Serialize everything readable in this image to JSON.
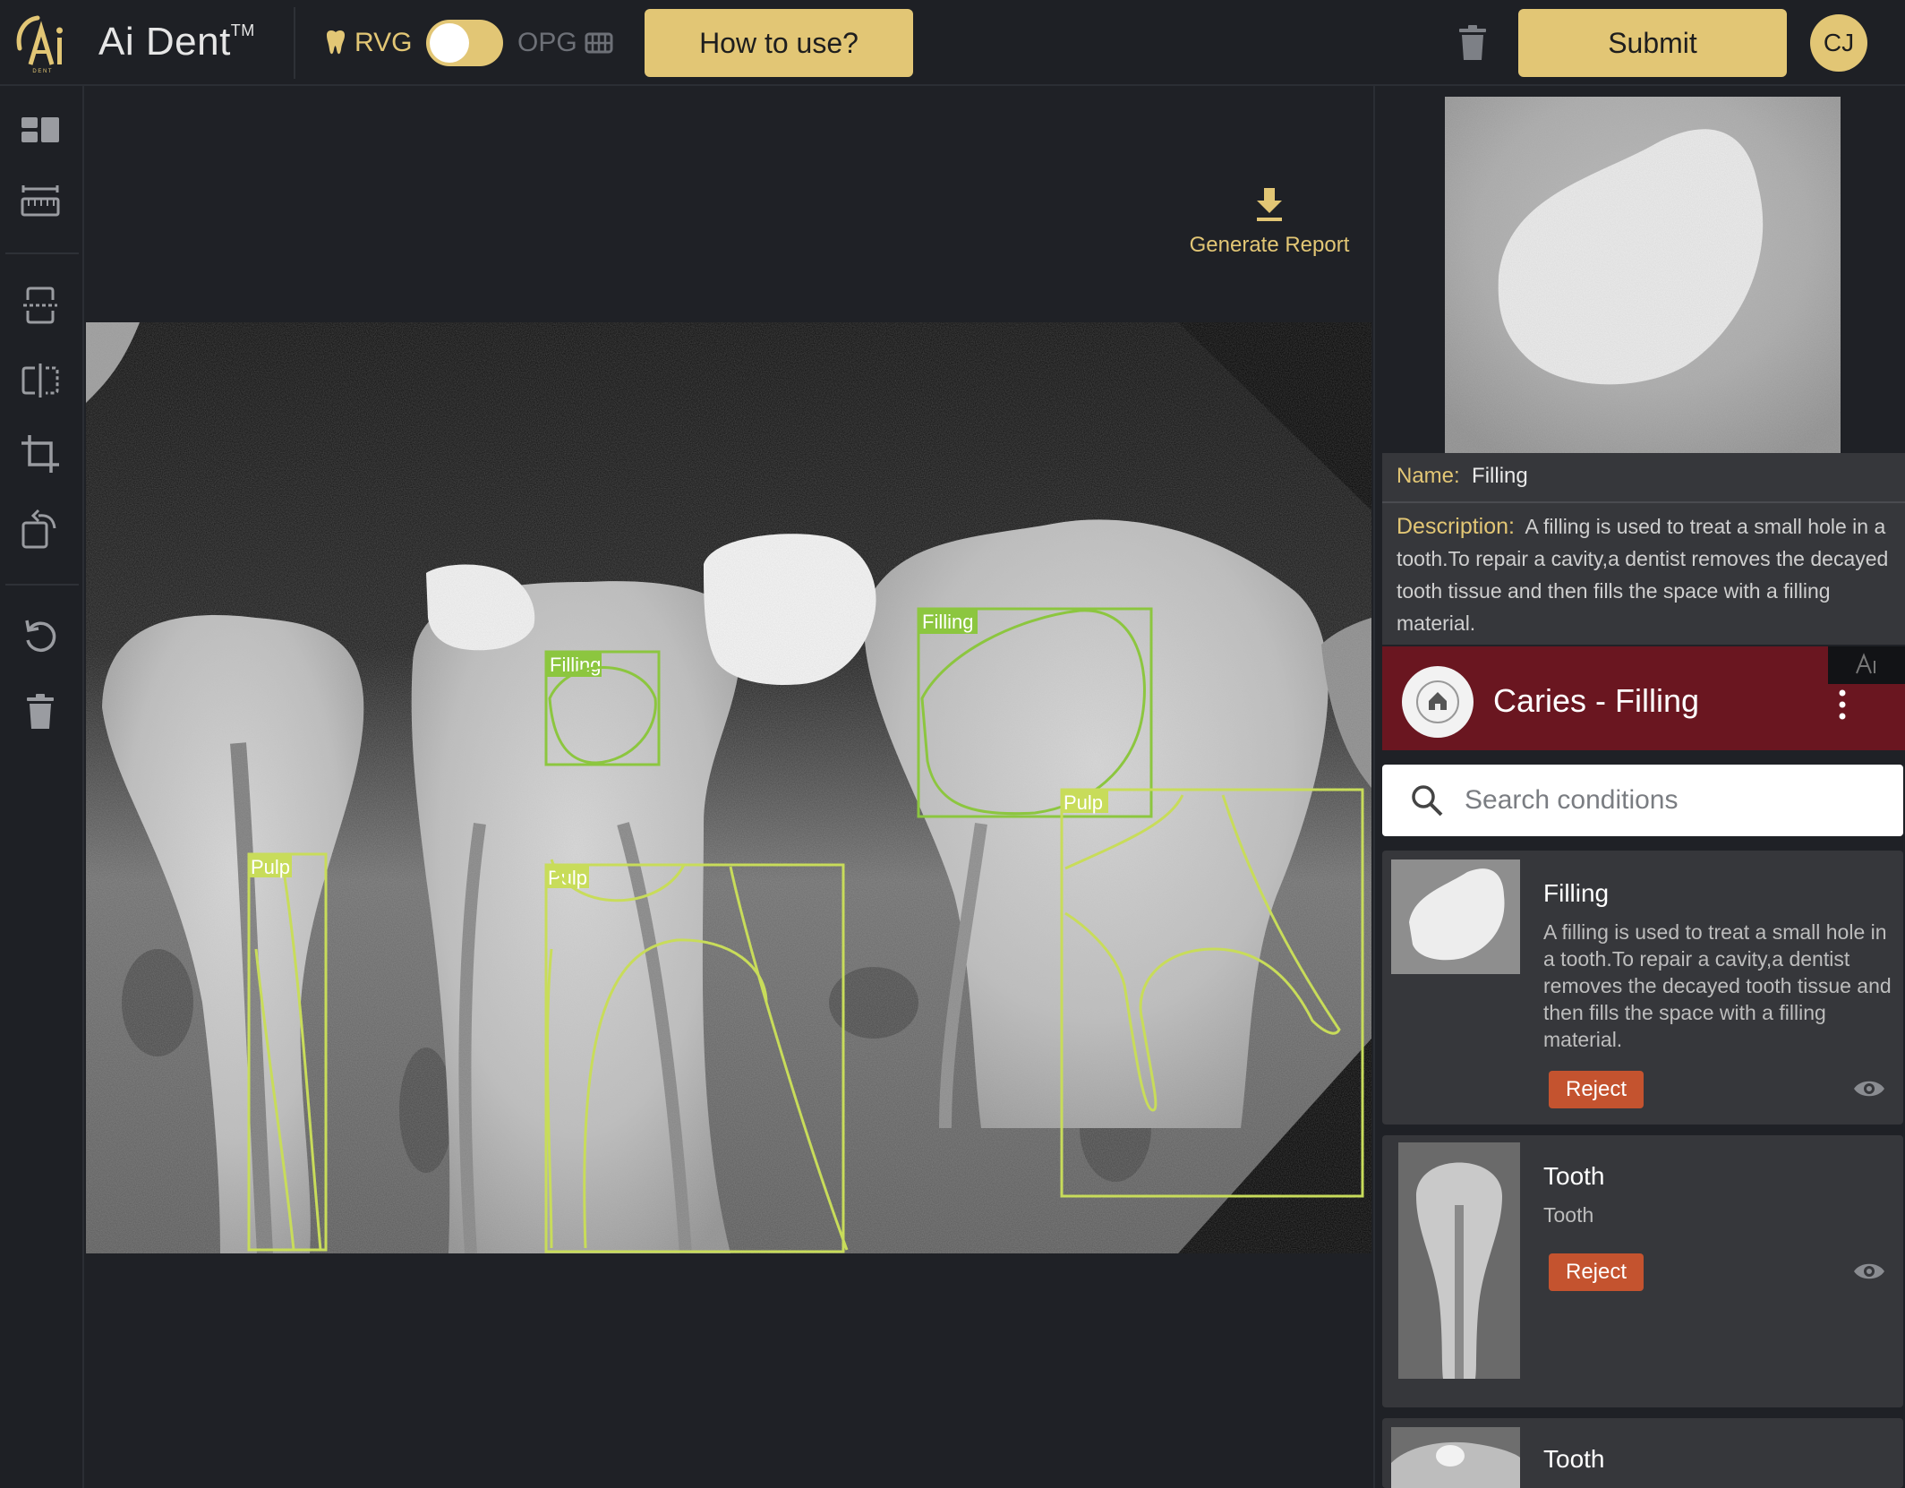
{
  "header": {
    "app_name": "Ai Dent",
    "trademark": "TM",
    "mode_rvg": "RVG",
    "mode_opg": "OPG",
    "how_to_use": "How to use?",
    "submit": "Submit",
    "user_initials": "CJ"
  },
  "toolbar": {
    "generate_report": "Generate Report"
  },
  "xray": {
    "annotations": [
      {
        "label": "Filling",
        "type": "filling"
      },
      {
        "label": "Filling",
        "type": "filling"
      },
      {
        "label": "Pulp",
        "type": "pulp"
      },
      {
        "label": "Pulp",
        "type": "pulp"
      },
      {
        "label": "Pulp",
        "type": "pulp"
      }
    ]
  },
  "detail": {
    "name_key": "Name:",
    "name_value": "Filling",
    "desc_key": "Description:",
    "desc_value": "A filling is used to treat a small hole in a tooth.To repair a cavity,a dentist removes the decayed tooth tissue and then fills the space with a filling material."
  },
  "video": {
    "title": "Caries - Filling"
  },
  "search": {
    "placeholder": "Search conditions"
  },
  "conditions": [
    {
      "title": "Filling",
      "desc": "A filling is used to treat a small hole in a tooth.To repair a cavity,a dentist removes the decayed tooth tissue and then fills the space with a filling material.",
      "reject": "Reject"
    },
    {
      "title": "Tooth",
      "desc": "Tooth",
      "reject": "Reject"
    },
    {
      "title": "Tooth"
    }
  ],
  "colors": {
    "accent": "#e2c675",
    "filling_box": "#8cc63f",
    "pulp_box": "#c8dc5a",
    "reject": "#c4532f"
  }
}
